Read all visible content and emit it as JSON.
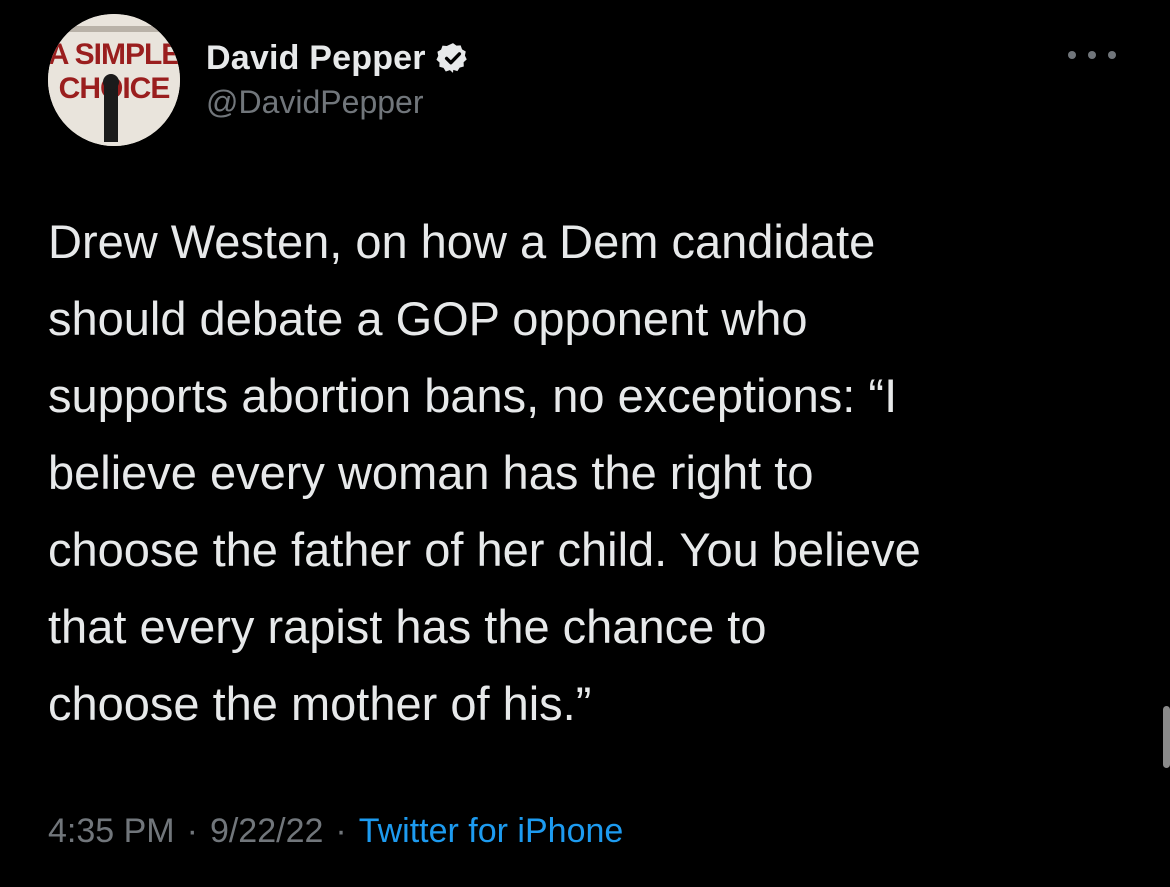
{
  "author": {
    "display_name": "David Pepper",
    "handle": "@DavidPepper",
    "avatar_text_line1": "A SIMPLE",
    "avatar_text_line2": "CHOICE",
    "verified_icon": "verified-badge-icon"
  },
  "more_icon": "more-options-icon",
  "tweet": {
    "text": "Drew Westen, on how a Dem candidate\nshould debate a GOP opponent who\nsupports abortion bans, no exceptions: “I\nbelieve every woman has the right to\nchoose the father of her child. You believe\nthat every rapist has the chance to\nchoose the mother of his.”"
  },
  "meta": {
    "time": "4:35 PM",
    "separator": "·",
    "date": "9/22/22",
    "source": "Twitter for iPhone"
  },
  "colors": {
    "background": "#000000",
    "primary_text": "#e7e9ea",
    "secondary_text": "#71767b",
    "link": "#1d9bf0"
  }
}
